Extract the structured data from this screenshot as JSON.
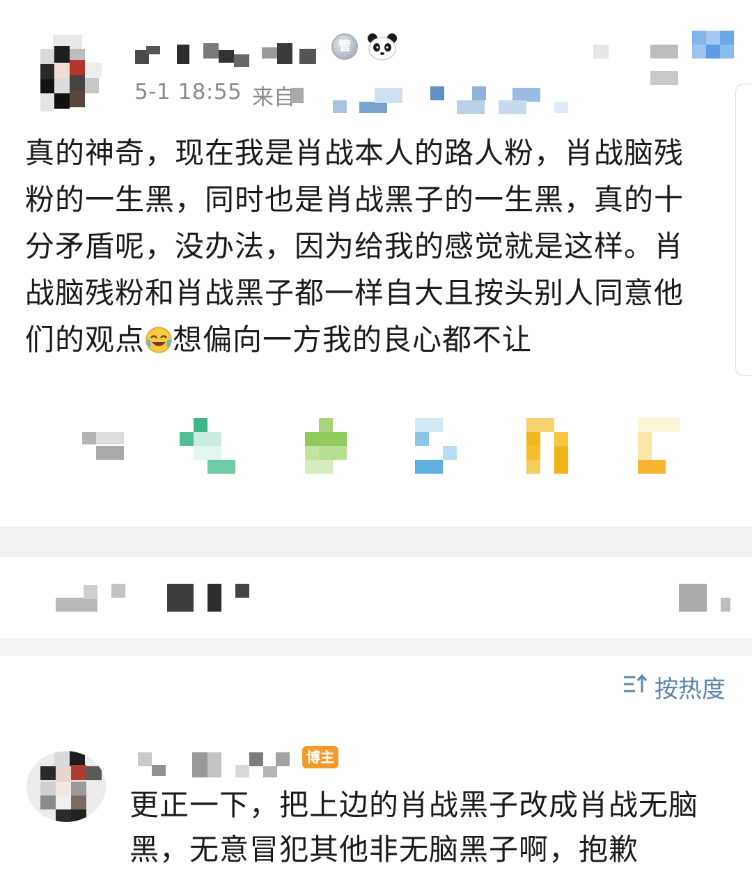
{
  "post": {
    "username": "",
    "time": "5-1 18:55",
    "source_prefix": "来自",
    "medal_icon_char": "管",
    "text_line1": "真的神奇，现在我是肖战本人的路人粉，肖战脑残",
    "text_line2": "粉的一生黑，同时也是肖战黑子的一生黑，真的十",
    "text_line3": "分矛盾呢，没办法，因为给我的感觉就是这样。肖",
    "text_line4": "战脑残粉和肖战黑子都一样自大且按头别人同意他",
    "text_line5a": "们的观点",
    "text_line5b": "想偏向一方我的良心都不让"
  },
  "sort": {
    "label": "按热度"
  },
  "reply": {
    "author_tag": "博主",
    "text_line1": "更正一下，把上边的肖战黑子改成肖战无脑",
    "text_line2": "黑，无意冒犯其他非无脑黑子啊，抱歉"
  },
  "colors": {
    "meta_gray": "#8c8c8c",
    "sort_blue": "#5b84ad",
    "author_tag_orange": "#f39a2c",
    "divider_gray": "#f1f1f1"
  }
}
